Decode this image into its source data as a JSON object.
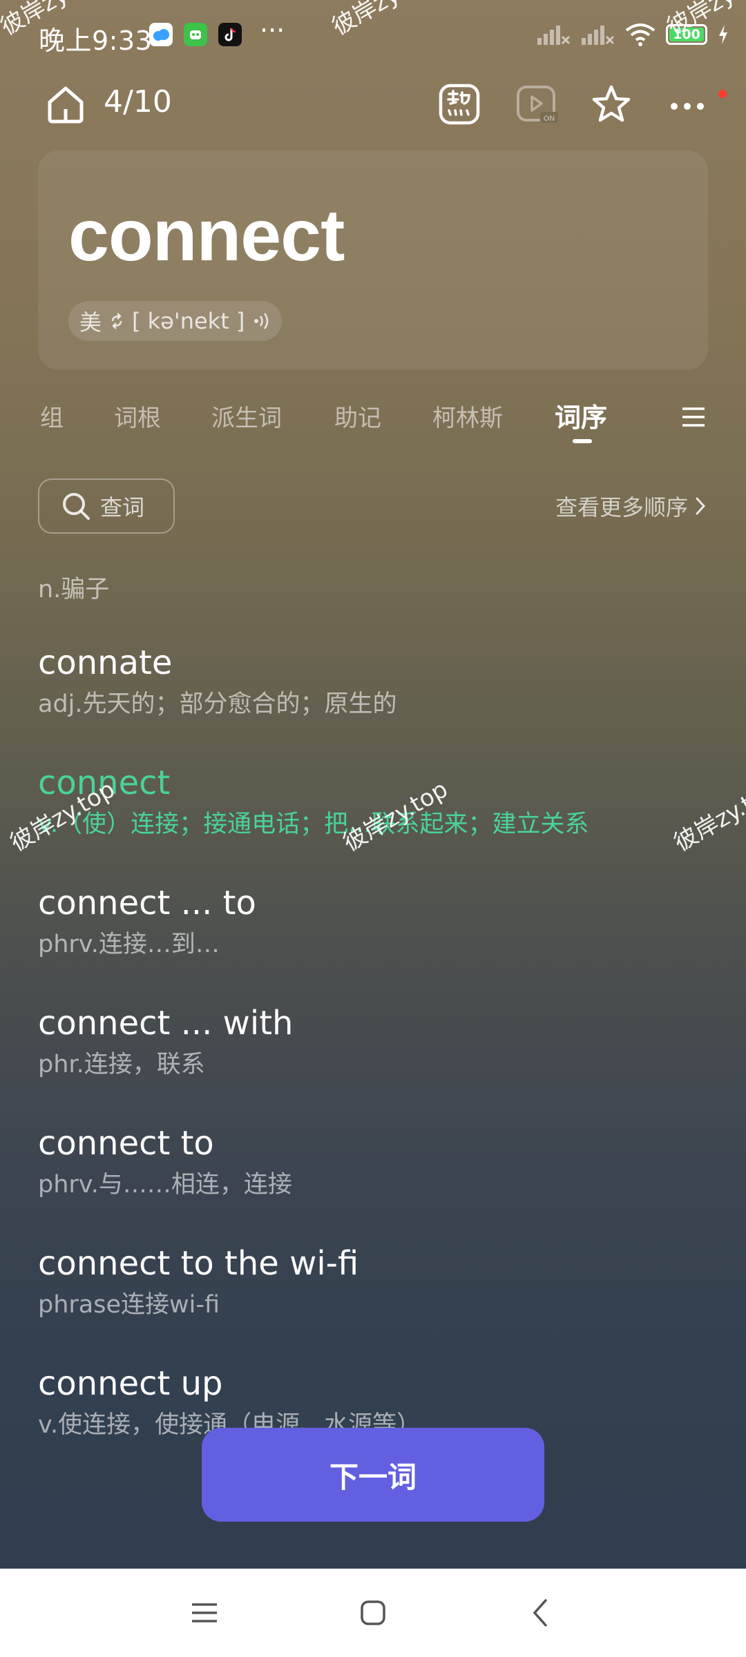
{
  "status_bar": {
    "time": "晚上9:33",
    "more": "···",
    "battery": "100"
  },
  "header": {
    "progress": "4/10"
  },
  "word": {
    "headword": "connect",
    "pron_region": "美",
    "phonetic": "[ kə'nekt ]"
  },
  "tabs": [
    {
      "label": "组"
    },
    {
      "label": "词根"
    },
    {
      "label": "派生词"
    },
    {
      "label": "助记"
    },
    {
      "label": "柯林斯"
    },
    {
      "label": "词序"
    }
  ],
  "search": {
    "label": "查词"
  },
  "more_order": {
    "label": "查看更多顺序"
  },
  "word_list": {
    "prev_def": "n.骗子",
    "entries": [
      {
        "word": "connate",
        "def": "adj.先天的；部分愈合的；原生的"
      },
      {
        "word": "connect",
        "def": "v.（使）连接；接通电话；把...联系起来；建立关系"
      },
      {
        "word": "connect ... to",
        "def": "phrv.连接…到…"
      },
      {
        "word": "connect ... with",
        "def": "phr.连接，联系"
      },
      {
        "word": "connect to",
        "def": "phrv.与……相连，连接"
      },
      {
        "word": "connect to the wi-fi",
        "def": "phrase连接wi-fi"
      },
      {
        "word": "connect up",
        "def": "v.使连接，使接通（电源、水源等）"
      }
    ]
  },
  "next_button": {
    "label": "下一词"
  },
  "watermark": {
    "text": "彼岸zy.top"
  },
  "colors": {
    "accent_green": "#49d39a",
    "next_button": "#6260e0"
  },
  "icons": {
    "home": "home-icon",
    "familiar": "familiar-icon",
    "video": "video-on-icon",
    "star": "star-icon",
    "more": "more-dots-icon",
    "tab_menu": "menu-icon",
    "search": "search-icon",
    "chevron": "chevron-right-icon"
  }
}
